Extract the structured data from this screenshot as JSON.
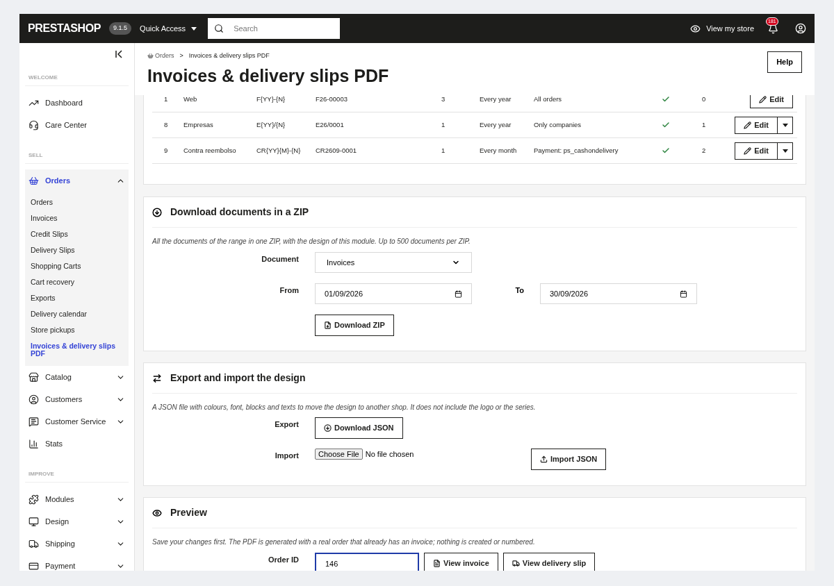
{
  "topbar": {
    "logo": "PRESTASHOP",
    "version": "9.1.5",
    "quick_access": "Quick Access",
    "search": {
      "placeholder": "Search"
    },
    "view_store": "View my store",
    "notifications": "181"
  },
  "sidebar": {
    "sections": [
      {
        "label": "WELCOME",
        "items": [
          {
            "kind": "link",
            "label": "Dashboard",
            "selected": false
          },
          {
            "kind": "link",
            "label": "Care Center",
            "selected": false
          }
        ]
      },
      {
        "label": "SELL",
        "items": [
          {
            "kind": "menu",
            "label": "Orders",
            "selected": true,
            "expanded": true,
            "children": [
              {
                "label": "Orders",
                "selected": false
              },
              {
                "label": "Invoices",
                "selected": false
              },
              {
                "label": "Credit Slips",
                "selected": false
              },
              {
                "label": "Delivery Slips",
                "selected": false
              },
              {
                "label": "Shopping Carts",
                "selected": false
              },
              {
                "label": "Cart recovery",
                "selected": false
              },
              {
                "label": "Exports",
                "selected": false
              },
              {
                "label": "Delivery calendar",
                "selected": false
              },
              {
                "label": "Store pickups",
                "selected": false
              },
              {
                "label": "Invoices & delivery slips PDF",
                "selected": true
              }
            ]
          },
          {
            "kind": "menu",
            "label": "Catalog",
            "selected": false,
            "expanded": false
          },
          {
            "kind": "menu",
            "label": "Customers",
            "selected": false,
            "expanded": false
          },
          {
            "kind": "menu",
            "label": "Customer Service",
            "selected": false,
            "expanded": false
          },
          {
            "kind": "link",
            "label": "Stats",
            "selected": false
          }
        ]
      },
      {
        "label": "IMPROVE",
        "items": [
          {
            "kind": "menu",
            "label": "Modules",
            "selected": false,
            "expanded": false
          },
          {
            "kind": "menu",
            "label": "Design",
            "selected": false,
            "expanded": false
          },
          {
            "kind": "menu",
            "label": "Shipping",
            "selected": false,
            "expanded": false
          },
          {
            "kind": "menu",
            "label": "Payment",
            "selected": false,
            "expanded": false
          }
        ]
      }
    ]
  },
  "breadcrumb": [
    "Orders",
    "Invoices & delivery slips PDF"
  ],
  "breadcrumb_separator": ">",
  "title": "Invoices & delivery slips PDF",
  "help": "Help",
  "table": {
    "rows": [
      {
        "cells": [
          "1",
          "Web",
          "F{YY}-{N}",
          "F26-00003",
          "3",
          "Every year",
          "All orders"
        ],
        "active": true,
        "column_9": "0",
        "action": "Edit",
        "dropdown": false
      },
      {
        "cells": [
          "8",
          "Empresas",
          "E{YY}/{N}",
          "E26/0001",
          "1",
          "Every year",
          "Only companies"
        ],
        "active": true,
        "column_9": "1",
        "action": "Edit",
        "dropdown": true
      },
      {
        "cells": [
          "9",
          "Contra reembolso",
          "CR{YY}{M}-{N}",
          "CR2609-0001",
          "1",
          "Every month",
          "Payment: ps_cashondelivery"
        ],
        "active": true,
        "column_9": "2",
        "action": "Edit",
        "dropdown": true
      }
    ]
  },
  "zip": {
    "title": "Download documents in a ZIP",
    "description": "All the documents of the range in one ZIP, with the design of this module. Up to 500 documents per ZIP.",
    "document": {
      "label": "Document",
      "value": "Invoices"
    },
    "from": {
      "label": "From",
      "value": "01/09/2026"
    },
    "to": {
      "label": "To",
      "value": "30/09/2026"
    },
    "button": "Download ZIP"
  },
  "design": {
    "title": "Export and import the design",
    "description": "A JSON file with colours, font, blocks and texts to move the design to another shop. It does not include the logo or the series.",
    "export": {
      "label": "Export",
      "button": "Download JSON"
    },
    "import": {
      "label": "Import",
      "file_button": "Choose File",
      "file_status": "No file chosen",
      "button": "Import JSON"
    }
  },
  "preview": {
    "title": "Preview",
    "description": "Save your changes first. The PDF is generated with a real order that already has an invoice; nothing is created or numbered.",
    "order_id": {
      "label": "Order ID",
      "value": "146",
      "focused": true
    },
    "buttons": [
      "View invoice",
      "View delivery slip"
    ]
  }
}
